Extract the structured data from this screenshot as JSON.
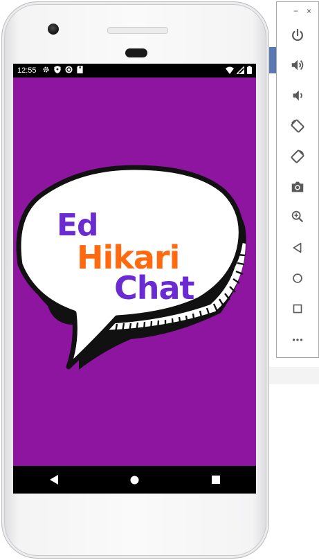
{
  "status_bar": {
    "time": "12:55"
  },
  "app": {
    "background": "#8d15a0",
    "logo": {
      "line1": "Ed",
      "line2": "Hikari",
      "line3": "Chat"
    }
  },
  "nav": {
    "back": "◀",
    "home": "●",
    "recents": "■"
  },
  "toolbar": {
    "minimize": "−",
    "close": "×",
    "items": [
      "power-icon",
      "volume-up-icon",
      "volume-down-icon",
      "rotate-left-icon",
      "rotate-right-icon",
      "camera-icon",
      "zoom-icon",
      "back-icon",
      "home-icon",
      "overview-icon",
      "more-icon"
    ]
  },
  "colors": {
    "purple_text": "#6a2bd2",
    "orange_text": "#ff6a10",
    "toolbar_icon": "#5a5a5a"
  }
}
